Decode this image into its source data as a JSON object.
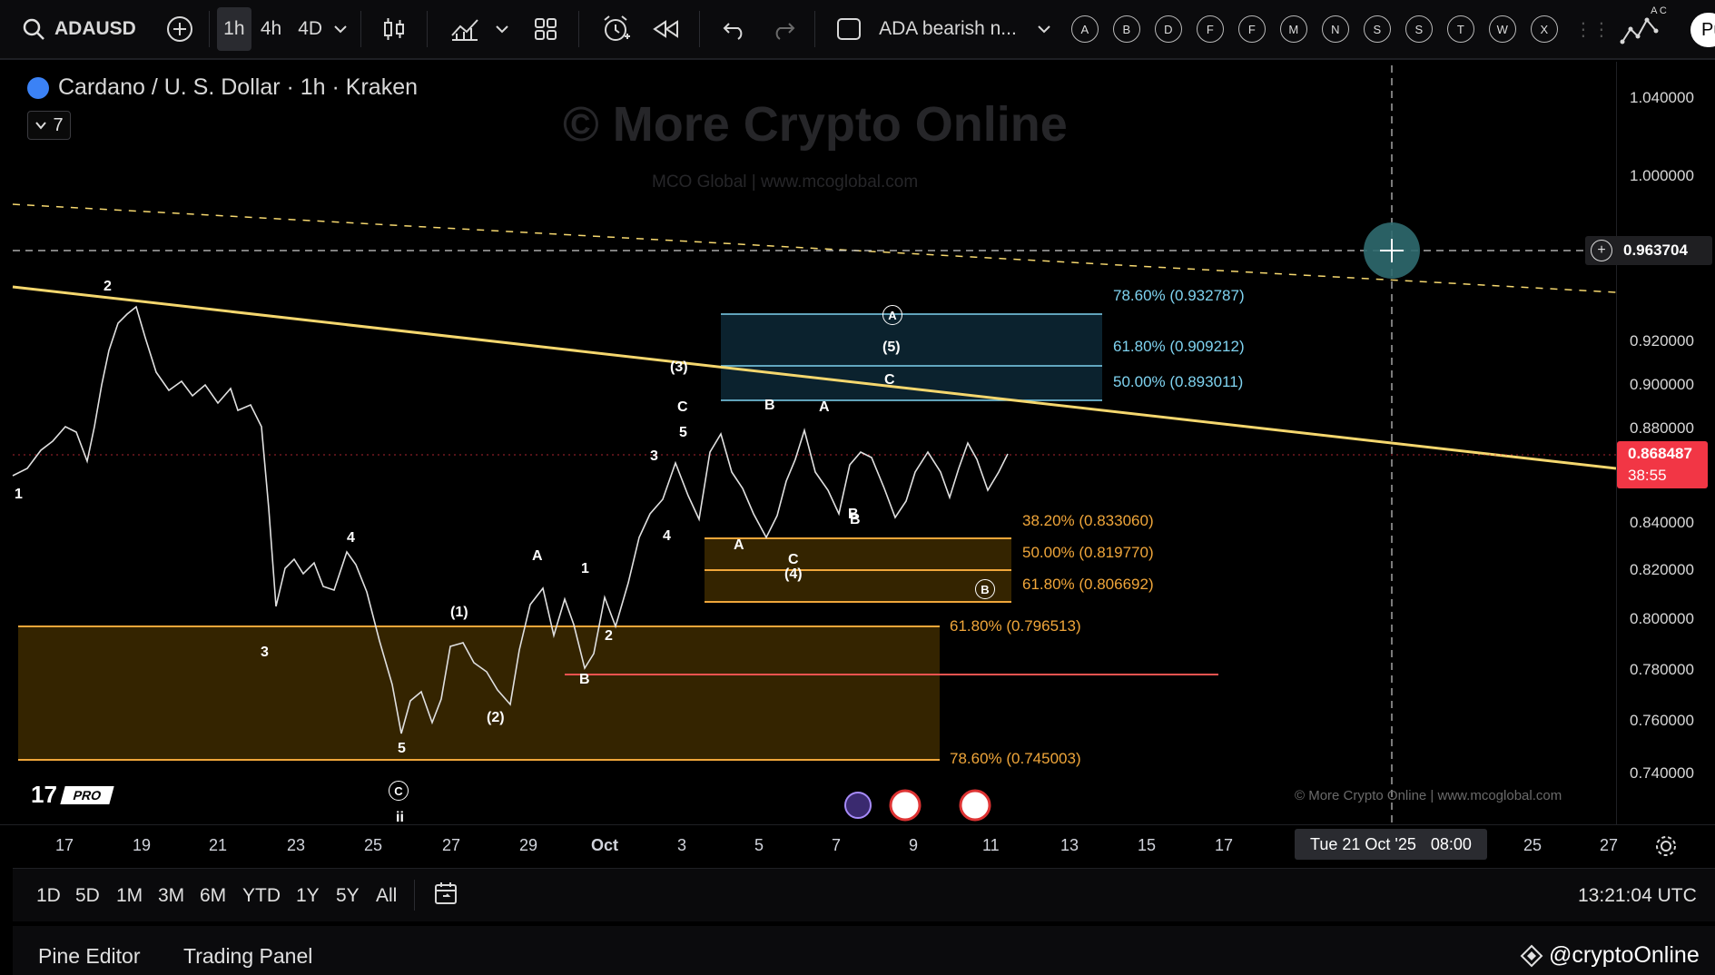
{
  "toolbar": {
    "symbol": "ADAUSD",
    "intervals": [
      "1h",
      "4h",
      "4D"
    ],
    "layout_name": "ADA bearish n...",
    "drawing_letters": [
      "A",
      "B",
      "D",
      "F",
      "F",
      "M",
      "N",
      "S",
      "S",
      "T",
      "W",
      "X"
    ],
    "publish_label": "Pu",
    "ac_label": "A C"
  },
  "chart_header": {
    "title": "Cardano / U. S. Dollar · 1h · Kraken",
    "collapse_count": "7"
  },
  "watermark": {
    "main": "© More Crypto Online",
    "sub": "MCO Global  |  www.mcoglobal.com",
    "footer": "© More Crypto Online  |  www.mcoglobal.com"
  },
  "price_axis": {
    "ticks": [
      "1.040000",
      "1.000000",
      "0.920000",
      "0.900000",
      "0.880000",
      "0.840000",
      "0.820000",
      "0.800000",
      "0.780000",
      "0.760000",
      "0.740000"
    ],
    "crosshair_price": "0.963704",
    "last_price": "0.868487",
    "countdown": "38:55"
  },
  "time_axis": {
    "ticks": [
      "17",
      "19",
      "21",
      "23",
      "25",
      "27",
      "29",
      "Oct",
      "3",
      "5",
      "7",
      "9",
      "11",
      "13",
      "15",
      "17",
      "25",
      "27"
    ],
    "crosshair_time": "Tue 21 Oct '25",
    "crosshair_clock": "08:00"
  },
  "fib_levels": {
    "upper": [
      "78.60% (0.932787)",
      "61.80% (0.909212)",
      "50.00% (0.893011)"
    ],
    "middle": [
      "38.20% (0.833060)",
      "50.00% (0.819770)",
      "61.80% (0.806692)"
    ],
    "lower": [
      "61.80% (0.796513)",
      "78.60% (0.745003)"
    ]
  },
  "wave_labels": {
    "list": [
      "2",
      "1",
      "3",
      "4",
      "5",
      "(1)",
      "(2)",
      "A",
      "1",
      "2",
      "B",
      "3",
      "4",
      "5",
      "C",
      "(3)",
      "A",
      "B",
      "C",
      "(4)",
      "B",
      "A",
      "B",
      "(5)",
      "C",
      "ii"
    ],
    "circled": [
      "A",
      "B",
      "C"
    ]
  },
  "bottom_bar": {
    "ranges": [
      "1D",
      "5D",
      "1M",
      "3M",
      "6M",
      "YTD",
      "1Y",
      "5Y",
      "All"
    ],
    "clock": "13:21:04 UTC"
  },
  "bottom_tabs": {
    "pine": "Pine Editor",
    "trading": "Trading Panel",
    "brand": "@cryptoOnline"
  },
  "colors": {
    "background": "#000000",
    "up": "#ffffff",
    "down": "#ef5350",
    "trendline": "#f5d76e",
    "fib_blue": "#7fd3f0",
    "fib_orange": "#f0a63a",
    "last_price": "#f23645"
  },
  "logo": {
    "text": "PRO"
  }
}
